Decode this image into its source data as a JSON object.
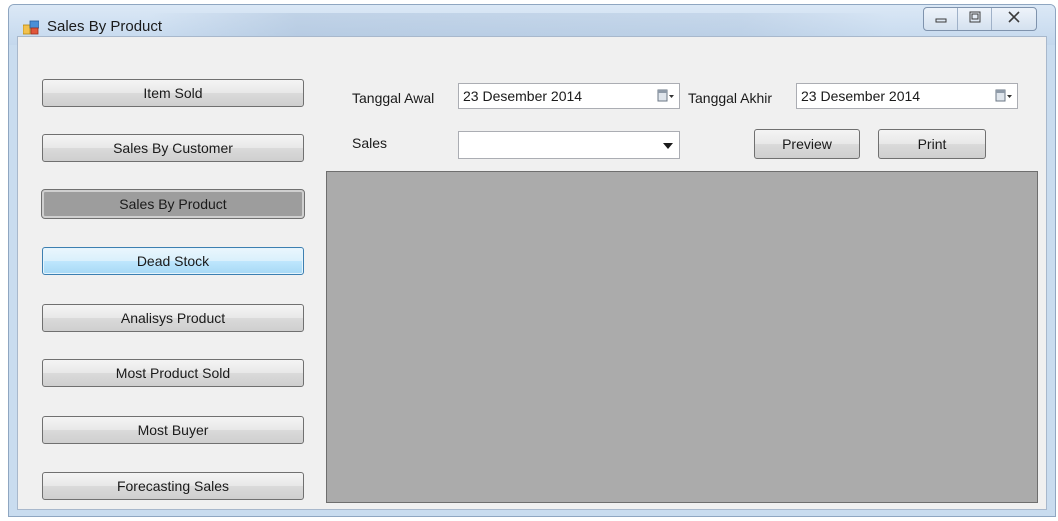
{
  "window": {
    "title": "Sales By Product",
    "icons": {
      "app": "app-window-icon",
      "minimize": "minimize-icon",
      "maximize": "maximize-icon",
      "close": "close-icon"
    }
  },
  "sidebar": {
    "items": [
      {
        "label": "Item Sold",
        "state": "normal"
      },
      {
        "label": "Sales By Customer",
        "state": "normal"
      },
      {
        "label": "Sales By Product",
        "state": "active"
      },
      {
        "label": "Dead Stock",
        "state": "focused"
      },
      {
        "label": "Analisys Product",
        "state": "normal"
      },
      {
        "label": "Most Product Sold",
        "state": "normal"
      },
      {
        "label": "Most Buyer",
        "state": "normal"
      },
      {
        "label": "Forecasting Sales",
        "state": "normal"
      }
    ]
  },
  "filters": {
    "start_date_label": "Tanggal Awal",
    "start_date_value": "23 Desember 2014",
    "end_date_label": "Tanggal Akhir",
    "end_date_value": "23 Desember 2014",
    "sales_label": "Sales",
    "sales_value": "",
    "calendar_icon": "calendar-dropdown-icon",
    "dropdown_icon": "chevron-down-icon"
  },
  "actions": {
    "preview_label": "Preview",
    "print_label": "Print"
  },
  "colors": {
    "viewer_background": "#ababab",
    "active_button": "#9d9d9d",
    "window_frame": "#c9dcef"
  }
}
